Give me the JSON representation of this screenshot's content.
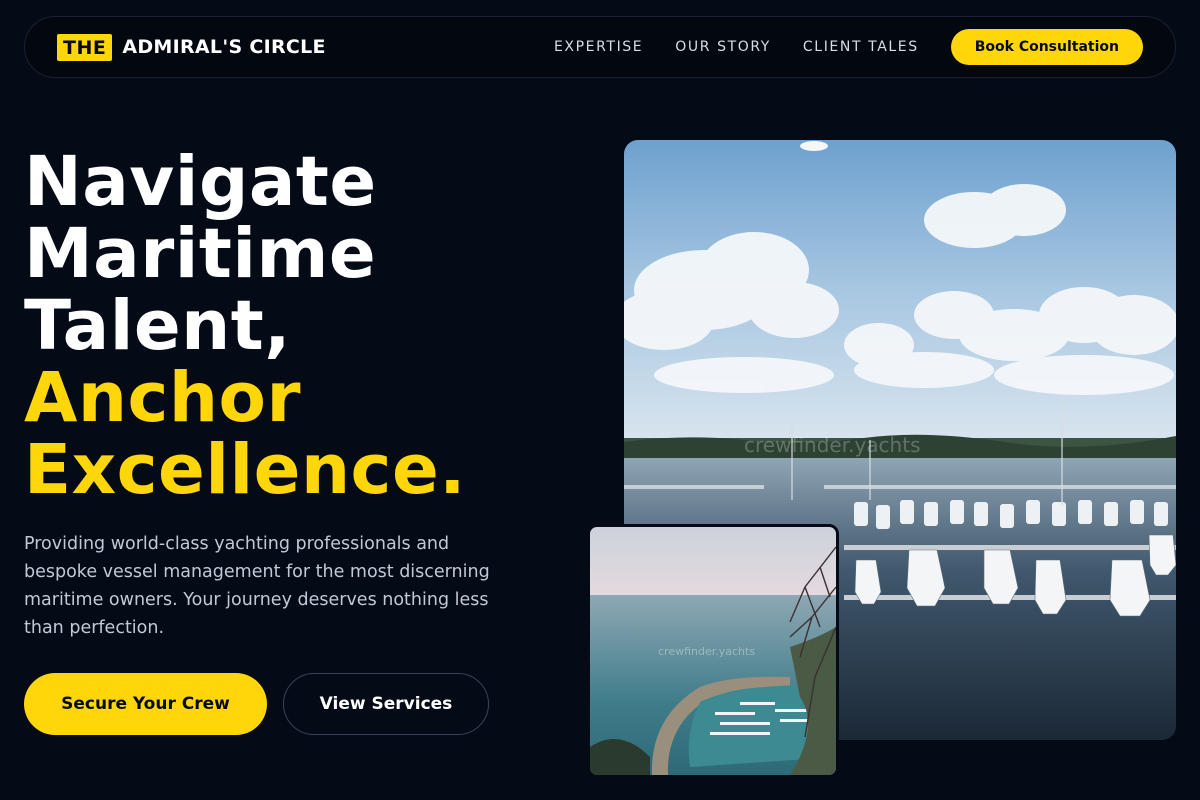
{
  "brand": {
    "badge": "THE",
    "name": "ADMIRAL'S CIRCLE"
  },
  "nav": {
    "links": [
      "EXPERTISE",
      "OUR STORY",
      "CLIENT TALES"
    ],
    "cta": "Book Consultation"
  },
  "hero": {
    "headline_lines": [
      "Navigate",
      "Maritime",
      "Talent,"
    ],
    "accent_lines": [
      "Anchor",
      "Excellence."
    ],
    "lede": "Providing world-class yachting professionals and bespoke vessel management for the most discerning maritime owners. Your journey deserves nothing less than perfection.",
    "primary_cta": "Secure Your Crew",
    "secondary_cta": "View Services"
  },
  "images": {
    "main": {
      "watermark": "crewfinder.yachts"
    },
    "small": {
      "watermark": "crewfinder.yachts"
    }
  },
  "colors": {
    "background": "#050b16",
    "accent": "#ffd60a",
    "text": "#ffffff",
    "muted": "#c2c9d6"
  }
}
